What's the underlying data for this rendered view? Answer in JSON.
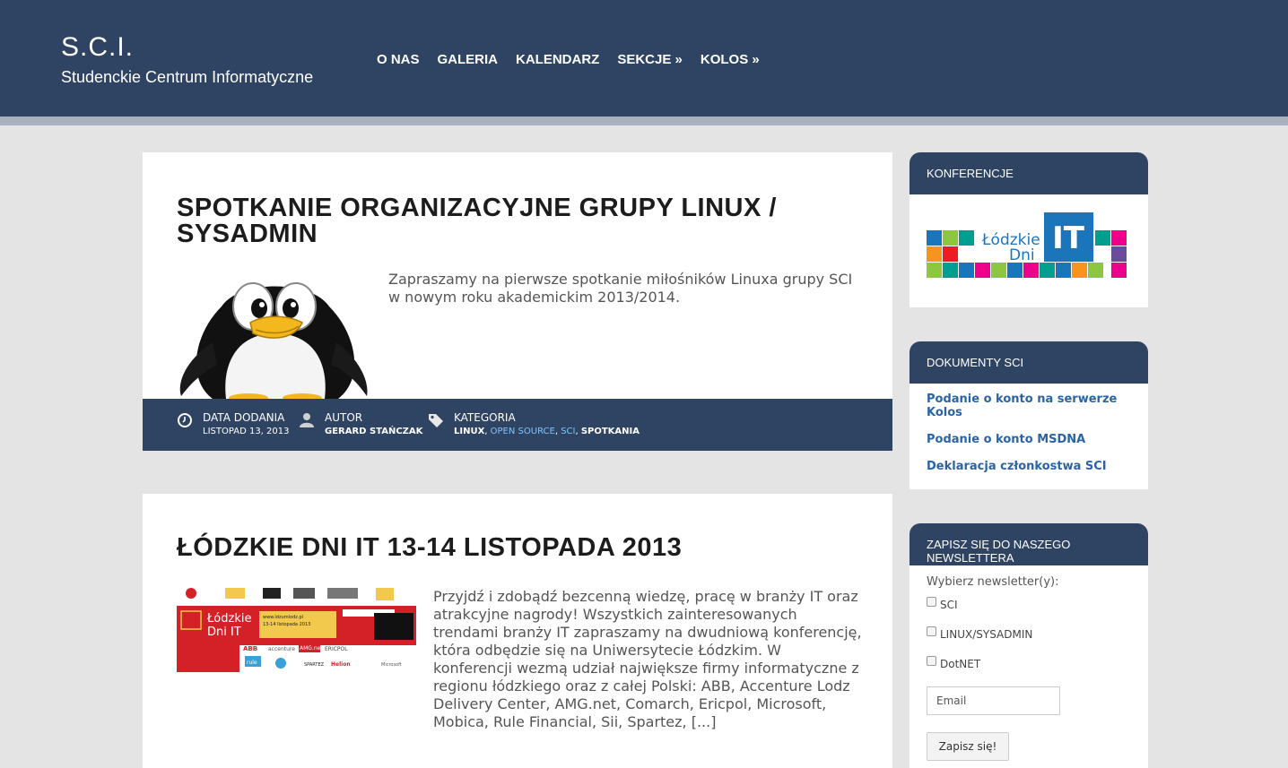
{
  "header": {
    "title": "S.C.I.",
    "subtitle": "Studenckie Centrum Informatyczne",
    "nav": [
      "O NAS",
      "GALERIA",
      "KALENDARZ",
      "SEKCJE »",
      "KOLOS »"
    ]
  },
  "posts": [
    {
      "title": "SPOTKANIE ORGANIZACYJNE GRUPY LINUX / SYSADMIN",
      "excerpt": "Zapraszamy na pierwsze spotkanie miłośników Linuxa grupy SCI w nowym roku akademickim 2013/2014.",
      "meta": {
        "date_label": "DATA DODANIA",
        "date_value": "LISTOPAD 13, 2013",
        "author_label": "AUTOR",
        "author_value": "GERARD STAŃCZAK",
        "category_label": "KATEGORIA",
        "categories": [
          "LINUX",
          "OPEN SOURCE",
          "SCI",
          "SPOTKANIA"
        ]
      }
    },
    {
      "title": "ŁÓDZKIE DNI IT 13-14 LISTOPADA 2013",
      "excerpt": "Przyjdź i zdobądź bezcenną wiedzę, pracę w branży IT oraz atrakcyjne nagrody! Wszystkich zainteresowanych trendami branży IT zapraszamy na dwudniową konferencję, która odbędzie się na Uniwersytecie Łódzkim. W konferencji wezmą udział największe firmy informatyczne z regionu łódzkiego oraz z całej Polski: ABB, Accenture Lodz Delivery Center, AMG.net, Comarch, Ericpol, Microsoft, Mobica, Rule Financial, Sii, Spartez, [...]",
      "banner": {
        "line1": "Łódzkie",
        "line2": "Dni IT",
        "url": "www.ldzumlodz.pl",
        "dates": "13-14 listopada 2013",
        "sponsors": [
          "ABB",
          "accenture",
          "AMG.net",
          "ERICPOL",
          "rule",
          "SPARTEZ",
          "Helion",
          "Microsoft"
        ]
      }
    }
  ],
  "sidebar": {
    "conferences": {
      "heading": "KONFERENCJE",
      "logo_text1": "Łódzkie",
      "logo_text2": "Dni",
      "logo_badge": "IT"
    },
    "documents": {
      "heading": "DOKUMENTY SCI",
      "links": [
        "Podanie o konto na serwerze Kolos",
        "Podanie o konto MSDNA",
        "Deklaracja członkostwa SCI"
      ]
    },
    "newsletter": {
      "heading": "ZAPISZ SIĘ DO NASZEGO NEWSLETTERA",
      "label": "Wybierz newsletter(y):",
      "options": [
        "SCI",
        "LINUX/SYSADMIN",
        "DotNET"
      ],
      "email_placeholder": "Email",
      "submit": "Zapisz się!"
    }
  },
  "colors": {
    "header_bg": "#2f4462",
    "page_bg": "#e4e4e4",
    "link": "#2b64a6",
    "meta_link": "#7fc3ff"
  },
  "icons": [
    "clock-icon",
    "user-icon",
    "tag-icon"
  ]
}
